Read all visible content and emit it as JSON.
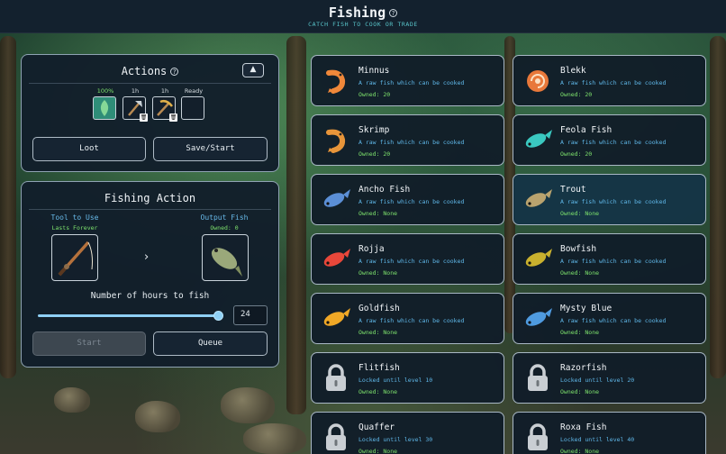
{
  "header": {
    "title": "Fishing",
    "subtitle": "CATCH FISH TO COOK OR TRADE"
  },
  "actions": {
    "title": "Actions",
    "slots": [
      {
        "label": "100%",
        "icon": "fish-leaf-icon"
      },
      {
        "label": "1h",
        "icon": "axe-icon"
      },
      {
        "label": "1h",
        "icon": "pickaxe-icon"
      },
      {
        "label": "Ready",
        "icon": ""
      }
    ],
    "loot_label": "Loot",
    "save_start_label": "Save/Start"
  },
  "fishing_action": {
    "title": "Fishing Action",
    "tool_label": "Tool to Use",
    "tool_sub": "Lasts Forever",
    "output_label": "Output Fish",
    "output_sub": "Owned: 0",
    "hours_label": "Number of hours to fish",
    "hours_value": "24",
    "hours_fraction": 1.0,
    "start_label": "Start",
    "queue_label": "Queue"
  },
  "fish": [
    {
      "name": "Minnus",
      "desc": "A raw fish which can be cooked",
      "owned": "Owned: 20",
      "color": "#f0883a",
      "icon": "shrimp-icon"
    },
    {
      "name": "Blekk",
      "desc": "A raw fish which can be cooked",
      "owned": "Owned: 20",
      "color": "#e8783a",
      "icon": "nautilus-icon"
    },
    {
      "name": "Skrimp",
      "desc": "A raw fish which can be cooked",
      "owned": "Owned: 20",
      "color": "#e8953a",
      "icon": "shrimp-icon"
    },
    {
      "name": "Feola Fish",
      "desc": "A raw fish which can be cooked",
      "owned": "Owned: 20",
      "color": "#3ac8c0",
      "icon": "fish-icon"
    },
    {
      "name": "Ancho Fish",
      "desc": "A raw fish which can be cooked",
      "owned": "Owned: None",
      "color": "#5b8fd6",
      "icon": "fish-icon"
    },
    {
      "name": "Trout",
      "desc": "A raw fish which can be cooked",
      "owned": "Owned: None",
      "color": "#b9a36e",
      "icon": "fish-icon"
    },
    {
      "name": "Rojja",
      "desc": "A raw fish which can be cooked",
      "owned": "Owned: None",
      "color": "#e8473a",
      "icon": "fish-icon"
    },
    {
      "name": "Bowfish",
      "desc": "A raw fish which can be cooked",
      "owned": "Owned: None",
      "color": "#c9b12e",
      "icon": "fish-icon"
    },
    {
      "name": "Goldfish",
      "desc": "A raw fish which can be cooked",
      "owned": "Owned: None",
      "color": "#f0a826",
      "icon": "fish-icon"
    },
    {
      "name": "Mysty Blue",
      "desc": "A raw fish which can be cooked",
      "owned": "Owned: None",
      "color": "#4f9be0",
      "icon": "fish-icon"
    },
    {
      "name": "Flitfish",
      "desc": "Locked until level 10",
      "owned": "Owned: None",
      "color": "#c9ced3",
      "icon": "lock-icon"
    },
    {
      "name": "Razorfish",
      "desc": "Locked until level 20",
      "owned": "Owned: None",
      "color": "#c9ced3",
      "icon": "lock-icon"
    },
    {
      "name": "Quaffer",
      "desc": "Locked until level 30",
      "owned": "Owned: None",
      "color": "#c9ced3",
      "icon": "lock-icon"
    },
    {
      "name": "Roxa Fish",
      "desc": "Locked until level 40",
      "owned": "Owned: None",
      "color": "#c9ced3",
      "icon": "lock-icon"
    }
  ]
}
